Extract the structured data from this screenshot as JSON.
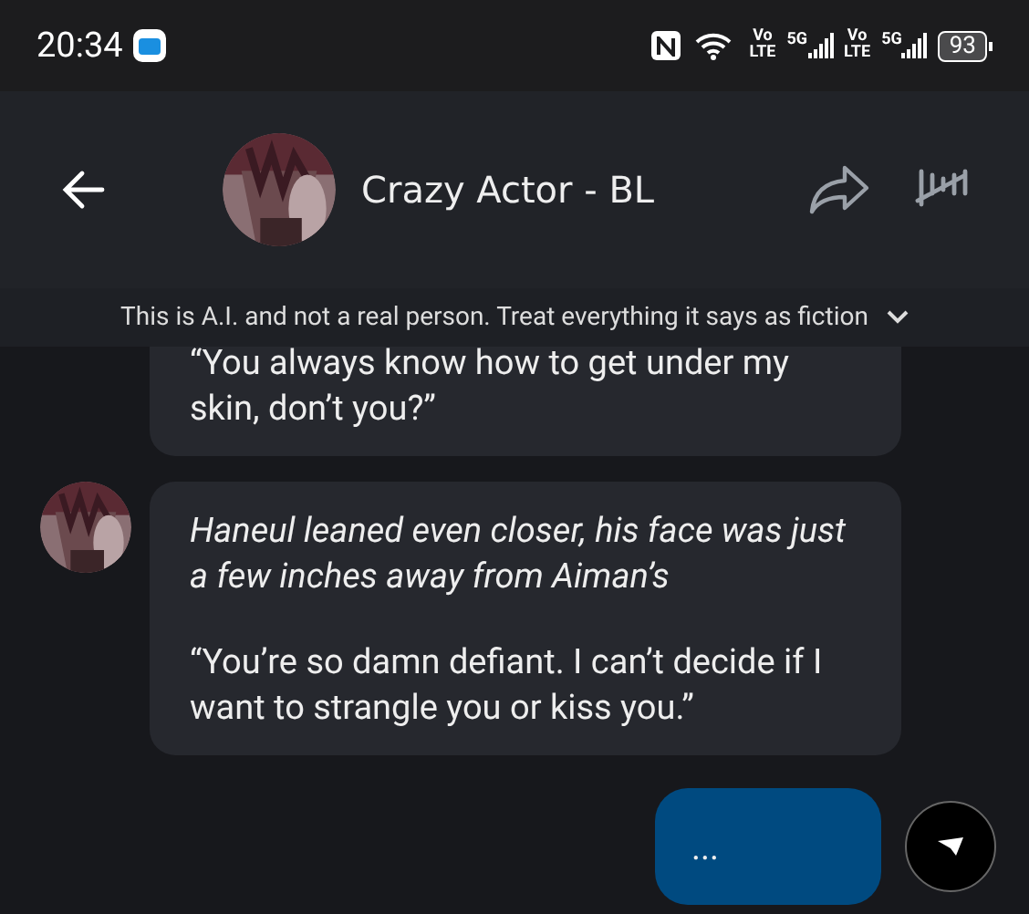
{
  "status_bar": {
    "time": "20:34",
    "battery": "93",
    "sim_1": {
      "volte": "Vo",
      "lte": "LTE",
      "network": "5G"
    },
    "sim_2": {
      "volte": "Vo",
      "lte": "LTE",
      "network": "5G"
    }
  },
  "header": {
    "title": "Crazy Actor - BL"
  },
  "disclaimer": "This is A.I. and not a real person. Treat everything it says as fiction",
  "messages": [
    {
      "kind": "bot",
      "avatar": false,
      "paragraphs": [
        {
          "kind": "speech",
          "text": "“You always know how to get under my skin, don’t you?”"
        }
      ]
    },
    {
      "kind": "bot",
      "avatar": true,
      "paragraphs": [
        {
          "kind": "narration",
          "text": "Haneul leaned even closer, his face was just a few inches away from Aiman’s"
        },
        {
          "kind": "speech",
          "text": "“You’re so damn defiant. I can’t decide if I want to strangle you or kiss you.”"
        }
      ]
    },
    {
      "kind": "user",
      "paragraphs": [
        {
          "kind": "speech",
          "text": "..."
        }
      ]
    }
  ]
}
